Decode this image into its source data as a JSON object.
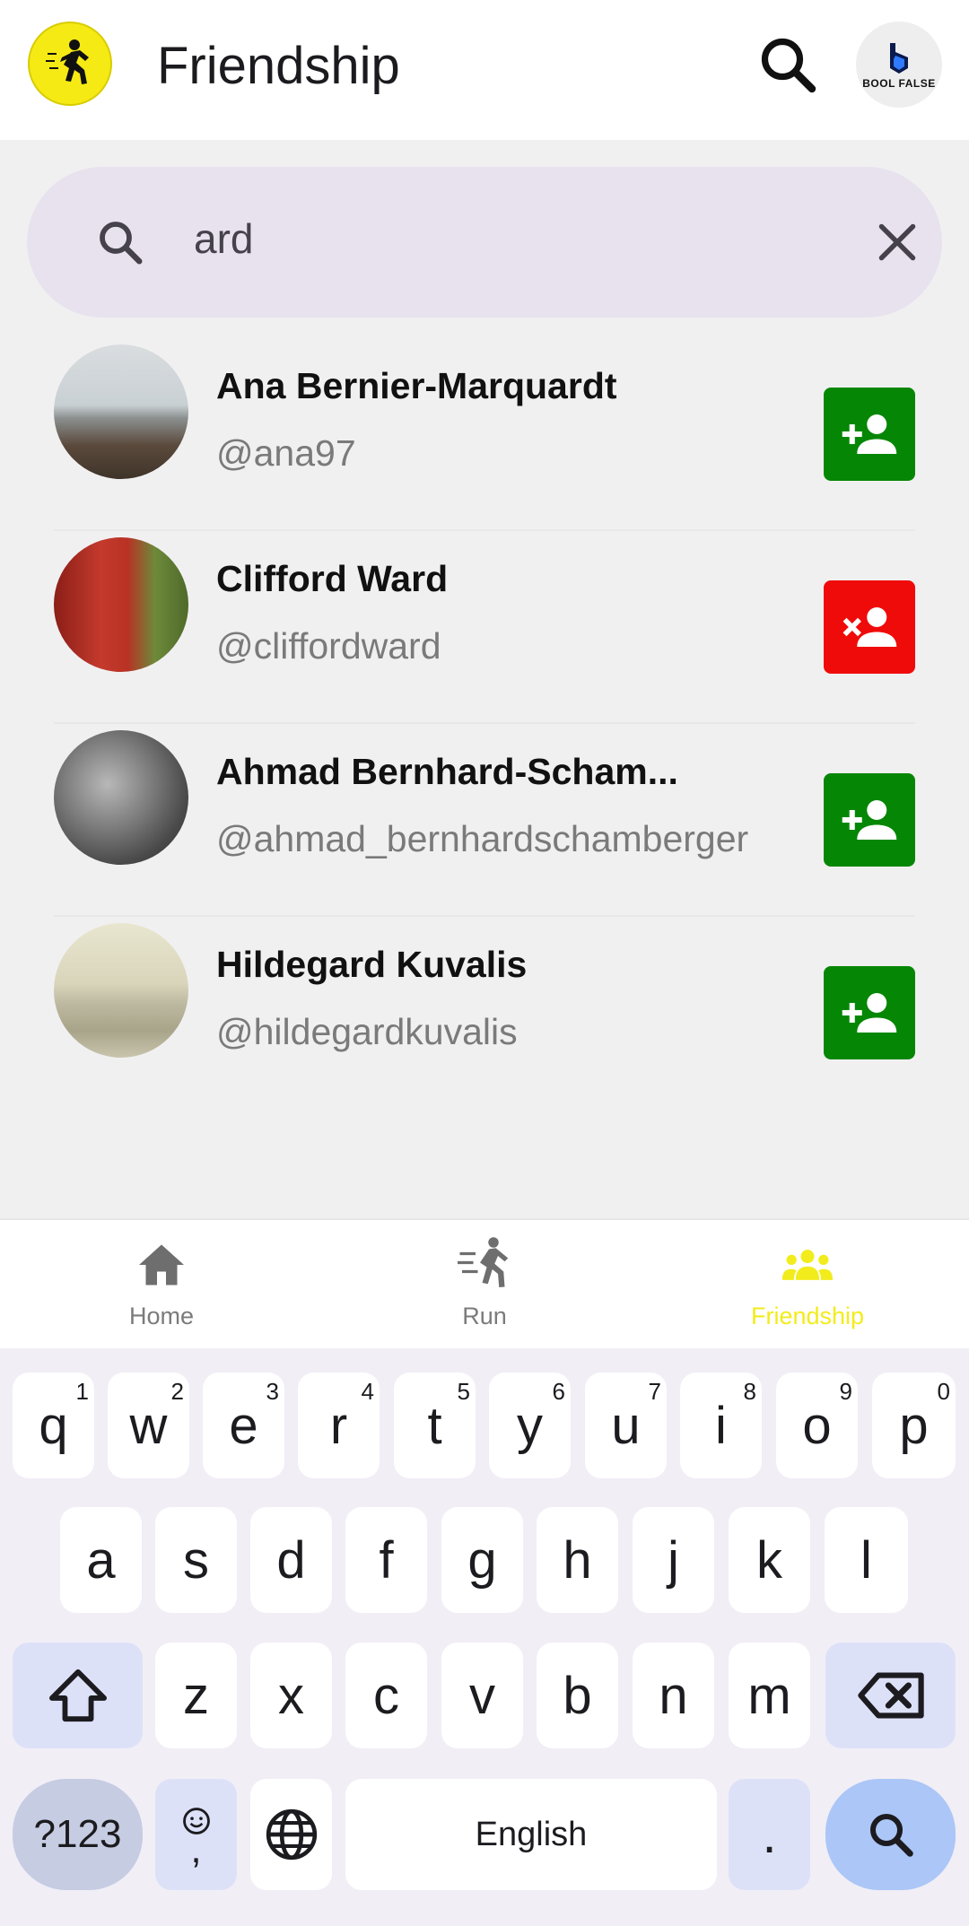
{
  "app": {
    "title": "Friendship",
    "brand_text": "BOOL FALSE"
  },
  "search": {
    "query": "ard"
  },
  "users": [
    {
      "name": "Ana Bernier-Marquardt",
      "handle": "@ana97",
      "action": "add"
    },
    {
      "name": "Clifford Ward",
      "handle": "@cliffordward",
      "action": "remove"
    },
    {
      "name": "Ahmad Bernhard-Scham...",
      "handle": "@ahmad_bernhardschamberger",
      "action": "add"
    },
    {
      "name": "Hildegard Kuvalis",
      "handle": "@hildegardkuvalis",
      "action": "add"
    }
  ],
  "nav": {
    "items": [
      {
        "label": "Home",
        "icon": "home-icon",
        "active": false
      },
      {
        "label": "Run",
        "icon": "run-icon",
        "active": false
      },
      {
        "label": "Friendship",
        "icon": "group-icon",
        "active": true
      }
    ]
  },
  "keyboard": {
    "row1": [
      {
        "k": "q",
        "h": "1"
      },
      {
        "k": "w",
        "h": "2"
      },
      {
        "k": "e",
        "h": "3"
      },
      {
        "k": "r",
        "h": "4"
      },
      {
        "k": "t",
        "h": "5"
      },
      {
        "k": "y",
        "h": "6"
      },
      {
        "k": "u",
        "h": "7"
      },
      {
        "k": "i",
        "h": "8"
      },
      {
        "k": "o",
        "h": "9"
      },
      {
        "k": "p",
        "h": "0"
      }
    ],
    "row2": [
      "a",
      "s",
      "d",
      "f",
      "g",
      "h",
      "j",
      "k",
      "l"
    ],
    "row3": [
      "z",
      "x",
      "c",
      "v",
      "b",
      "n",
      "m"
    ],
    "symbols_label": "?123",
    "emoji_comma": ",",
    "space_label": "English",
    "period": "."
  },
  "colors": {
    "add_button": "#058705",
    "remove_button": "#f00b0b",
    "active_nav": "#f2ec1c",
    "logo_bg": "#f5ea14"
  }
}
